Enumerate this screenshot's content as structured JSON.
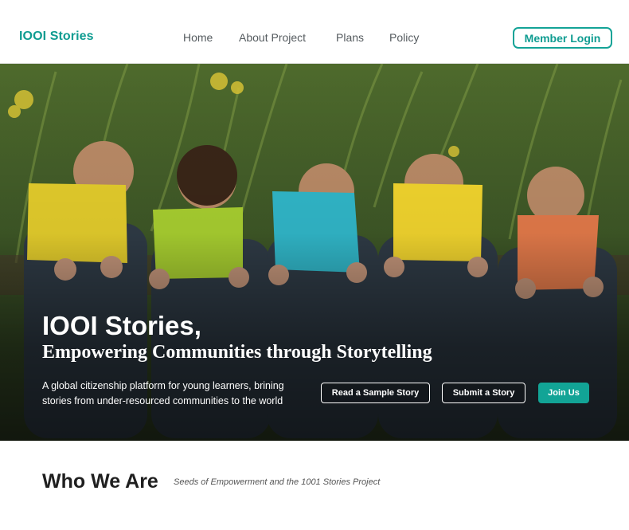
{
  "header": {
    "brand": "IOOI Stories",
    "nav": [
      "Home",
      "About Project",
      "Plans",
      "Policy"
    ],
    "login_label": "Member Login"
  },
  "hero": {
    "image_icon": "children-reading-books-photo",
    "title": "IOOI Stories,",
    "subtitle": "Empowering Communities through Storytelling",
    "description": "A global citizenship platform for young learners, brining stories from under-resourced communities to the world",
    "buttons": {
      "sample": "Read a Sample Story",
      "submit": "Submit a Story",
      "join": "Join Us"
    }
  },
  "who": {
    "title": "Who We Are",
    "subtitle": "Seeds of Empowerment and the 1001 Stories Project"
  },
  "colors": {
    "accent": "#14a397",
    "nav_text": "#555b5f"
  }
}
